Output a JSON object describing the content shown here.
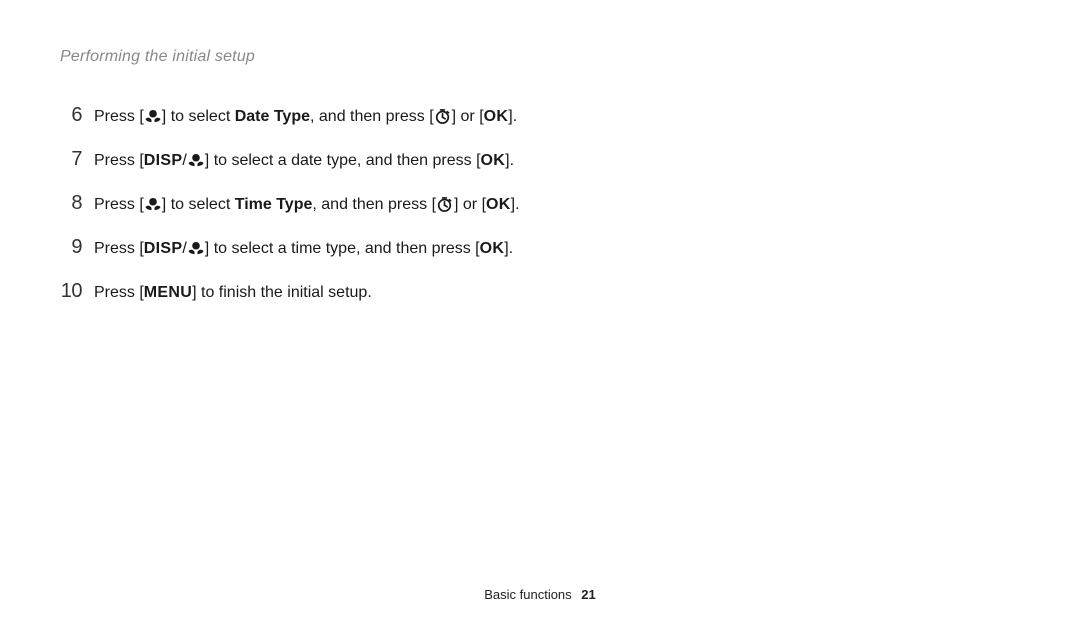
{
  "header": {
    "title": "Performing the initial setup"
  },
  "labels": {
    "date_type": "Date Type",
    "time_type": "Time Type",
    "disp": "DISP",
    "ok": "OK",
    "menu": "MENU"
  },
  "text": {
    "press": "Press [",
    "to_select": "] to select ",
    "to_select_a_date": "] to select a date type, and then press [",
    "to_select_a_time": "] to select a time type, and then press [",
    "and_then_press": ", and then press [",
    "or": "] or [",
    "dot": "].",
    "finish": "] to finish the initial setup."
  },
  "steps": [
    {
      "num": "6"
    },
    {
      "num": "7"
    },
    {
      "num": "8"
    },
    {
      "num": "9"
    },
    {
      "num": "10"
    }
  ],
  "footer": {
    "section": "Basic functions",
    "page": "21"
  }
}
